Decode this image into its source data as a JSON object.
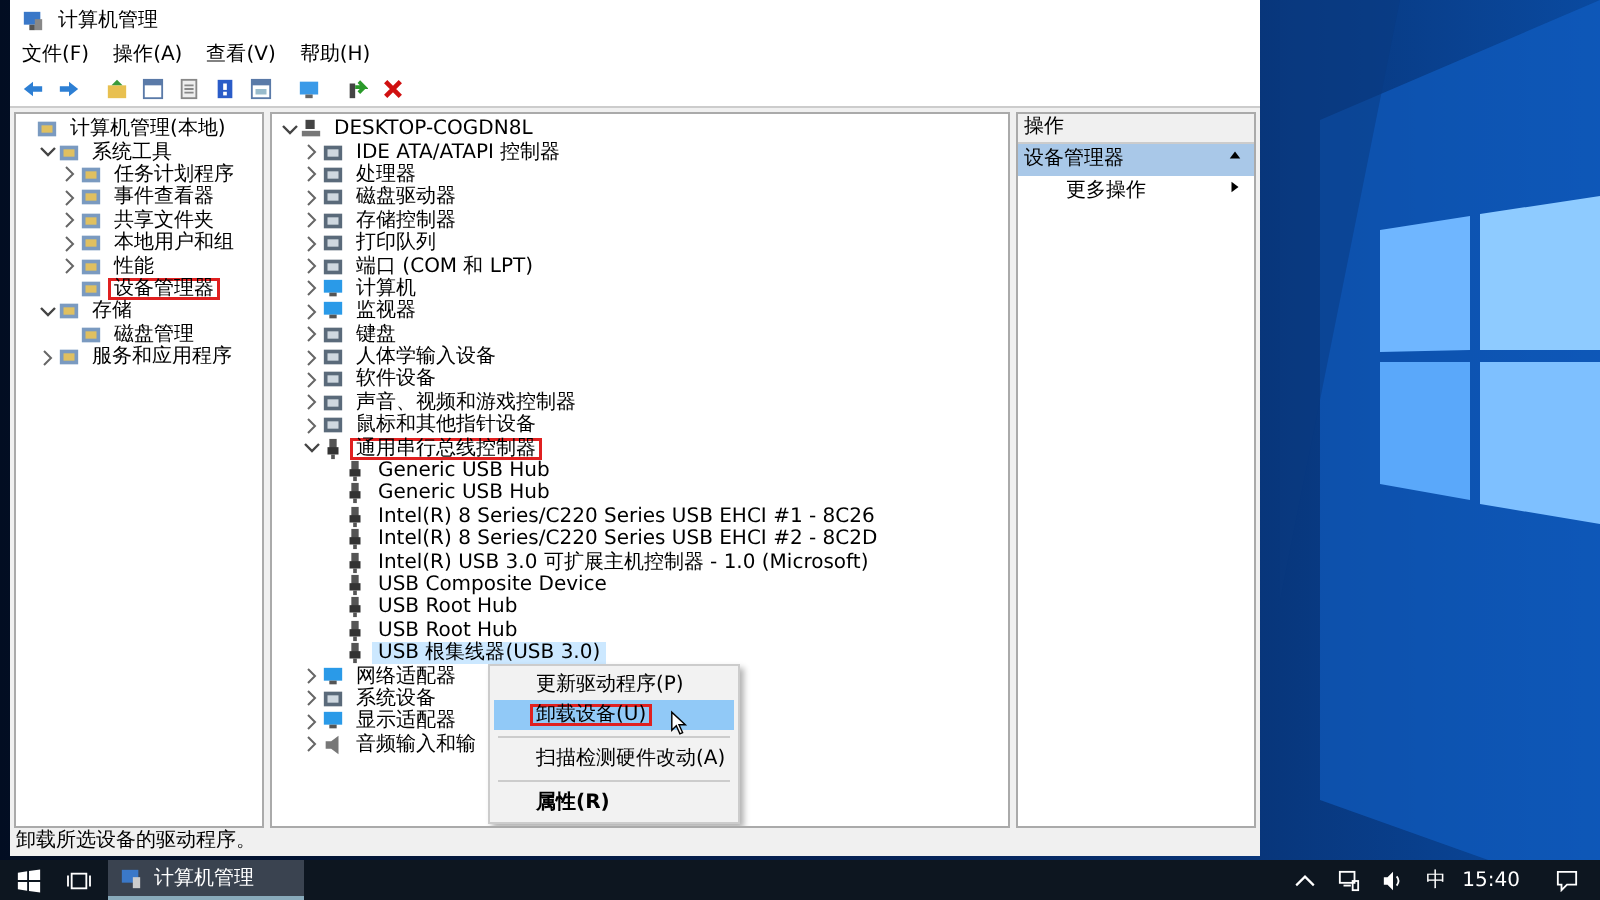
{
  "window": {
    "title": "计算机管理"
  },
  "menu_bar": [
    "文件(F)",
    "操作(A)",
    "查看(V)",
    "帮助(H)"
  ],
  "console_tree": [
    {
      "label": "计算机管理(本地)",
      "annotated": false,
      "children": [
        {
          "label": "系统工具",
          "expanded": true,
          "annotated": false,
          "children": [
            {
              "label": "任务计划程序",
              "expanded": false,
              "annotated": false
            },
            {
              "label": "事件查看器",
              "expanded": false,
              "annotated": false
            },
            {
              "label": "共享文件夹",
              "expanded": false,
              "annotated": false
            },
            {
              "label": "本地用户和组",
              "expanded": false,
              "annotated": false
            },
            {
              "label": "性能",
              "expanded": false,
              "annotated": false
            },
            {
              "label": "设备管理器",
              "annotated": true
            }
          ]
        },
        {
          "label": "存储",
          "expanded": true,
          "annotated": false,
          "children": [
            {
              "label": "磁盘管理",
              "annotated": false
            }
          ]
        },
        {
          "label": "服务和应用程序",
          "expanded": false,
          "annotated": false
        }
      ]
    }
  ],
  "device_tree": [
    {
      "label": "DESKTOP-COGDN8L",
      "expanded": true,
      "kind": "computer",
      "selected": false,
      "annotated": false,
      "children": [
        {
          "label": "IDE ATA/ATAPI 控制器",
          "expanded": false,
          "kind": "category",
          "selected": false,
          "annotated": false
        },
        {
          "label": "处理器",
          "expanded": false,
          "kind": "category",
          "selected": false,
          "annotated": false
        },
        {
          "label": "磁盘驱动器",
          "expanded": false,
          "kind": "category",
          "selected": false,
          "annotated": false
        },
        {
          "label": "存储控制器",
          "expanded": false,
          "kind": "category",
          "selected": false,
          "annotated": false
        },
        {
          "label": "打印队列",
          "expanded": false,
          "kind": "category",
          "selected": false,
          "annotated": false
        },
        {
          "label": "端口 (COM 和 LPT)",
          "expanded": false,
          "kind": "category",
          "selected": false,
          "annotated": false
        },
        {
          "label": "计算机",
          "expanded": false,
          "kind": "monitor",
          "selected": false,
          "annotated": false
        },
        {
          "label": "监视器",
          "expanded": false,
          "kind": "monitor",
          "selected": false,
          "annotated": false
        },
        {
          "label": "键盘",
          "expanded": false,
          "kind": "category",
          "selected": false,
          "annotated": false
        },
        {
          "label": "人体学输入设备",
          "expanded": false,
          "kind": "category",
          "selected": false,
          "annotated": false
        },
        {
          "label": "软件设备",
          "expanded": false,
          "kind": "category",
          "selected": false,
          "annotated": false
        },
        {
          "label": "声音、视频和游戏控制器",
          "expanded": false,
          "kind": "category",
          "selected": false,
          "annotated": false
        },
        {
          "label": "鼠标和其他指针设备",
          "expanded": false,
          "kind": "category",
          "selected": false,
          "annotated": false
        },
        {
          "label": "通用串行总线控制器",
          "expanded": true,
          "kind": "usb",
          "selected": false,
          "annotated": true,
          "children": [
            {
              "label": "Generic USB Hub",
              "kind": "usb",
              "selected": false,
              "annotated": false
            },
            {
              "label": "Generic USB Hub",
              "kind": "usb",
              "selected": false,
              "annotated": false
            },
            {
              "label": "Intel(R) 8 Series/C220 Series USB EHCI #1 - 8C26",
              "kind": "usb",
              "selected": false,
              "annotated": false
            },
            {
              "label": "Intel(R) 8 Series/C220 Series USB EHCI #2 - 8C2D",
              "kind": "usb",
              "selected": false,
              "annotated": false
            },
            {
              "label": "Intel(R) USB 3.0 可扩展主机控制器 - 1.0 (Microsoft)",
              "kind": "usb",
              "selected": false,
              "annotated": false
            },
            {
              "label": "USB Composite Device",
              "kind": "usb",
              "selected": false,
              "annotated": false
            },
            {
              "label": "USB Root Hub",
              "kind": "usb",
              "selected": false,
              "annotated": false
            },
            {
              "label": "USB Root Hub",
              "kind": "usb",
              "selected": false,
              "annotated": false
            },
            {
              "label": "USB 根集线器(USB 3.0)",
              "kind": "usb",
              "selected": true,
              "annotated": false
            }
          ]
        },
        {
          "label": "网络适配器",
          "expanded": false,
          "kind": "monitor",
          "selected": false,
          "annotated": false
        },
        {
          "label": "系统设备",
          "expanded": false,
          "kind": "category",
          "selected": false,
          "annotated": false
        },
        {
          "label": "显示适配器",
          "expanded": false,
          "kind": "monitor",
          "selected": false,
          "annotated": false
        },
        {
          "label": "音频输入和输",
          "expanded": false,
          "kind": "speaker",
          "selected": false,
          "annotated": false
        }
      ]
    }
  ],
  "context_menu": [
    {
      "kind": "item",
      "label": "更新驱动程序(P)",
      "hovered": false,
      "bold": false,
      "annotated": false
    },
    {
      "kind": "item",
      "label": "卸载设备(U)",
      "hovered": true,
      "bold": false,
      "annotated": true
    },
    {
      "kind": "separator"
    },
    {
      "kind": "item",
      "label": "扫描检测硬件改动(A)",
      "hovered": false,
      "bold": false,
      "annotated": false
    },
    {
      "kind": "separator"
    },
    {
      "kind": "item",
      "label": "属性(R)",
      "hovered": false,
      "bold": true,
      "annotated": false
    }
  ],
  "actions_pane": {
    "header": "操作",
    "section": "设备管理器",
    "items": [
      "更多操作"
    ]
  },
  "status_bar": "卸载所选设备的驱动程序。",
  "taskbar": {
    "apps": [
      {
        "label": "计算机管理",
        "active": true
      }
    ],
    "ime": "中",
    "clock": "15:40"
  }
}
